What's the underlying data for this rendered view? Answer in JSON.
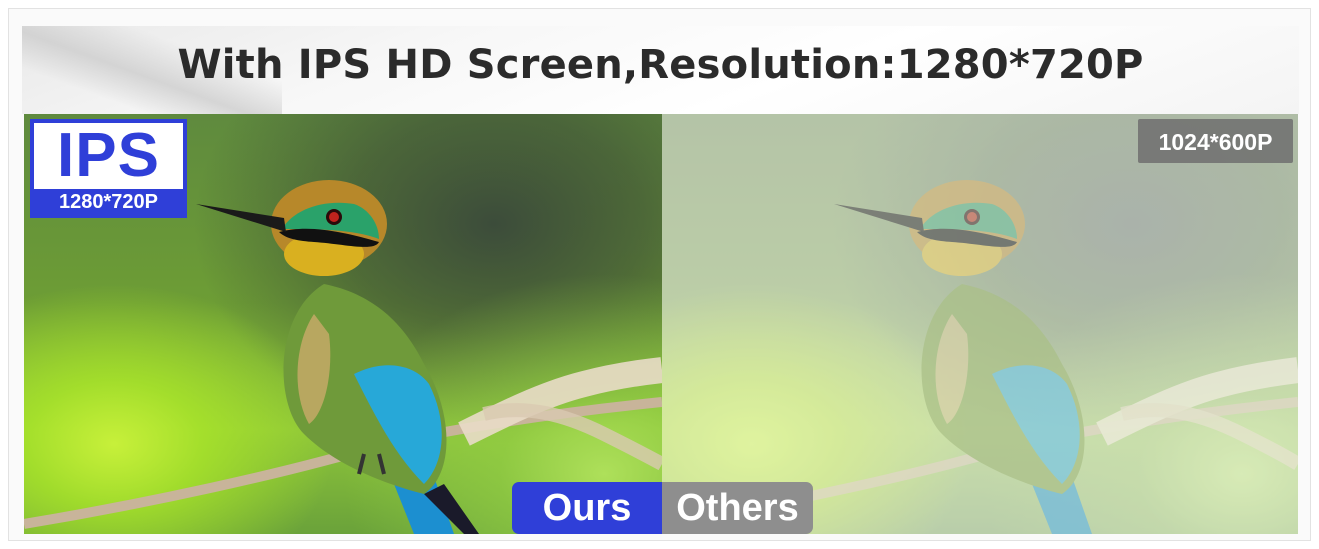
{
  "headline": "With IPS HD Screen,Resolution:1280*720P",
  "left_panel": {
    "badge_title": "IPS",
    "badge_resolution": "1280*720P"
  },
  "right_panel": {
    "badge_resolution": "1024*600P"
  },
  "comparison_tabs": {
    "ours": "Ours",
    "others": "Others"
  },
  "colors": {
    "accent_blue": "#2f3fd8",
    "others_gray": "#8e8e8e",
    "headline_text": "#2b2b2b"
  }
}
